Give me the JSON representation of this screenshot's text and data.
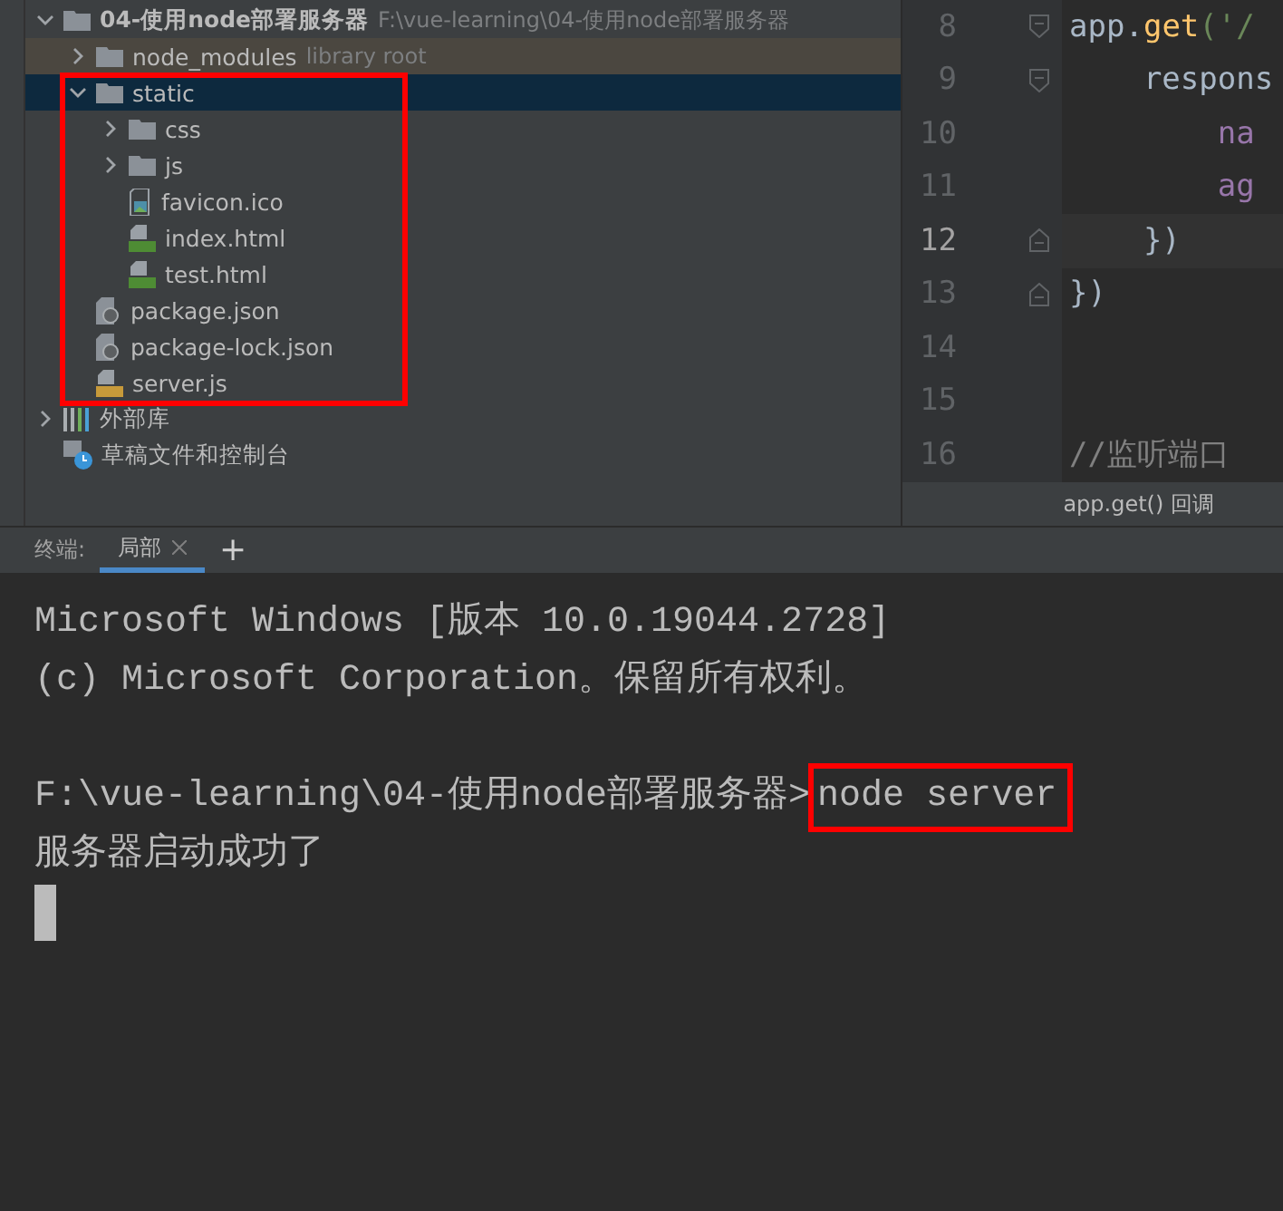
{
  "project_tree": {
    "items": [
      {
        "kind": "folder",
        "name": "04-使用node部署服务器",
        "path": "F:\\vue-learning\\04-使用node部署服务器",
        "expanded": true,
        "selected": false,
        "children": [
          {
            "kind": "folder",
            "name": "node_modules",
            "hint": "library root",
            "expanded": false,
            "selected": false
          },
          {
            "kind": "folder",
            "name": "static",
            "expanded": true,
            "selected": true,
            "children": [
              {
                "kind": "folder",
                "name": "css",
                "expanded": false,
                "selected": false
              },
              {
                "kind": "folder",
                "name": "js",
                "expanded": false,
                "selected": false
              },
              {
                "kind": "image",
                "name": "favicon.ico",
                "selected": false
              },
              {
                "kind": "html",
                "name": "index.html",
                "selected": false
              },
              {
                "kind": "html",
                "name": "test.html",
                "selected": false
              }
            ]
          },
          {
            "kind": "json",
            "name": "package.json",
            "selected": false
          },
          {
            "kind": "json",
            "name": "package-lock.json",
            "selected": false
          },
          {
            "kind": "js",
            "name": "server.js",
            "selected": false
          }
        ]
      },
      {
        "kind": "library",
        "name": "外部库",
        "expanded": false,
        "selected": false
      },
      {
        "kind": "scratch",
        "name": "草稿文件和控制台",
        "selected": false
      }
    ]
  },
  "editor": {
    "lines": [
      {
        "number": "8",
        "current": false,
        "kind": "fold_start",
        "tokens": [
          {
            "text": "app.",
            "kind": "plain"
          },
          {
            "text": "get",
            "kind": "func"
          },
          {
            "text": "('/",
            "kind": "string"
          }
        ]
      },
      {
        "number": "9",
        "current": false,
        "kind": "fold_start",
        "tokens": [
          {
            "text": "    respons",
            "kind": "plain"
          }
        ]
      },
      {
        "number": "10",
        "current": false,
        "kind": "plain",
        "tokens": [
          {
            "text": "        na",
            "kind": "field"
          }
        ]
      },
      {
        "number": "11",
        "current": false,
        "kind": "plain",
        "tokens": [
          {
            "text": "        ag",
            "kind": "field"
          }
        ]
      },
      {
        "number": "12",
        "current": true,
        "kind": "fold_end",
        "tokens": [
          {
            "text": "    })",
            "kind": "plain"
          }
        ]
      },
      {
        "number": "13",
        "current": false,
        "kind": "fold_end",
        "tokens": [
          {
            "text": "})",
            "kind": "plain"
          }
        ]
      },
      {
        "number": "14",
        "current": false,
        "kind": "plain"
      },
      {
        "number": "15",
        "current": false,
        "kind": "plain"
      },
      {
        "number": "16",
        "current": false,
        "kind": "plain",
        "tokens": [
          {
            "text": "//监听端口",
            "kind": "comment"
          }
        ]
      }
    ],
    "breadcrumb": "app.get() 回调"
  },
  "terminal": {
    "label": "终端:",
    "tabs": [
      {
        "label": "局部",
        "selected": true
      }
    ],
    "add": "+",
    "lines": [
      {
        "kind": "output",
        "text": "Microsoft Windows [版本 10.0.19044.2728]"
      },
      {
        "kind": "output",
        "text": "(c) Microsoft Corporation。保留所有权利。"
      },
      {
        "kind": "prompt",
        "text": "F:\\vue-learning\\04-使用node部署服务器>",
        "command": "node server"
      },
      {
        "kind": "output",
        "text": "服务器启动成功了"
      }
    ]
  }
}
